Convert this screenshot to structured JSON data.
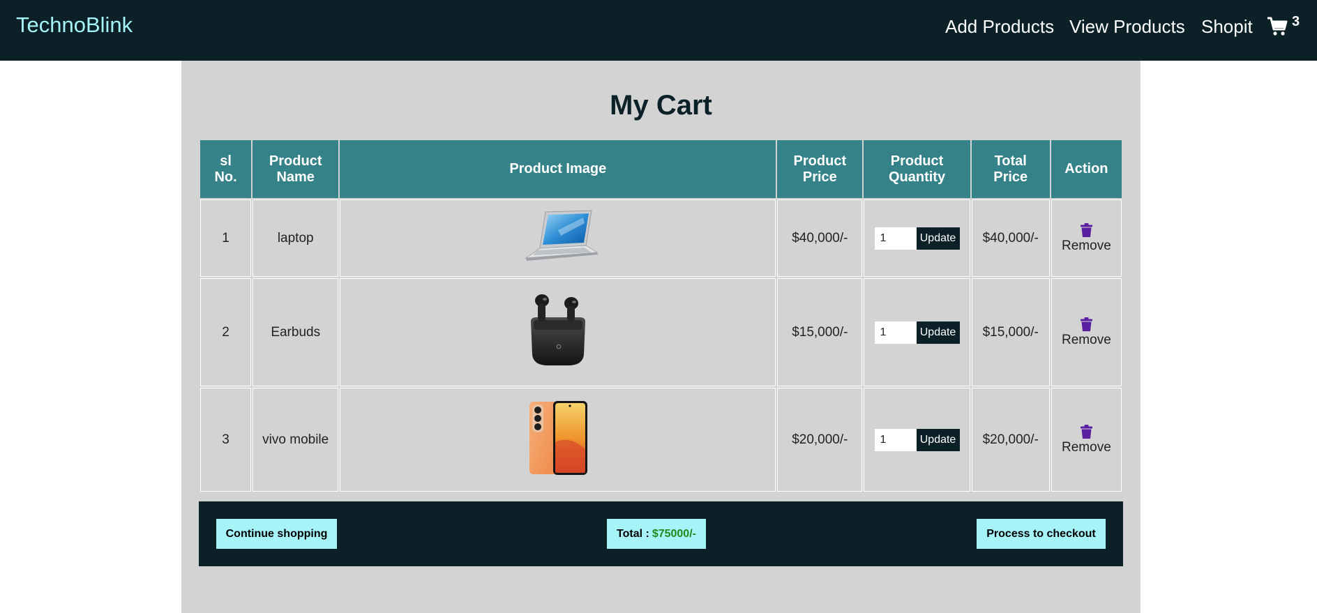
{
  "brand": "TechnoBlink",
  "nav": {
    "add_products": "Add Products",
    "view_products": "View Products",
    "shopit": "Shopit",
    "cart_count": "3"
  },
  "page_title": "My Cart",
  "table": {
    "headers": [
      "sl No.",
      "Product Name",
      "Product Image",
      "Product Price",
      "Product Quantity",
      "Total Price",
      "Action"
    ],
    "rows": [
      {
        "sl": "1",
        "name": "laptop",
        "image": "laptop-image",
        "price": "$40,000/-",
        "qty": "1",
        "update_label": "Update",
        "total": "$40,000/-",
        "remove_label": "Remove"
      },
      {
        "sl": "2",
        "name": "Earbuds",
        "image": "earbuds-image",
        "price": "$15,000/-",
        "qty": "1",
        "update_label": "Update",
        "total": "$15,000/-",
        "remove_label": "Remove"
      },
      {
        "sl": "3",
        "name": "vivo mobile",
        "image": "mobile-image",
        "price": "$20,000/-",
        "qty": "1",
        "update_label": "Update",
        "total": "$20,000/-",
        "remove_label": "Remove"
      }
    ]
  },
  "footer": {
    "continue_label": "Continue shopping",
    "total_label": "Total :",
    "total_amount": "$75000/-",
    "checkout_label": "Process to checkout"
  },
  "colors": {
    "navbar": "#0b2027",
    "brand": "#a6f3f8",
    "header_cell": "#358388",
    "panel": "#d3d3d3",
    "trash_icon": "#5a1fa0",
    "total_amount": "#1e8a1e"
  }
}
